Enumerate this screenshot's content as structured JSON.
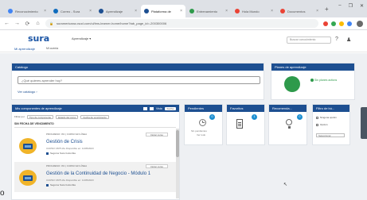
{
  "browser": {
    "tabs": [
      {
        "label": "Reconocimiento",
        "color": "#4285f4",
        "active": false
      },
      {
        "label": "Correo - Sura",
        "color": "#0f6cbd",
        "active": false
      },
      {
        "label": "Aprendizaje",
        "color": "#1d4f91",
        "active": false
      },
      {
        "label": "Plataforma de",
        "color": "#1d4f91",
        "active": true
      },
      {
        "label": "Entrenamiento",
        "color": "#2e9a4b",
        "active": false
      },
      {
        "label": "Hola Mundo",
        "color": "#ea4335",
        "active": false
      },
      {
        "label": "Documentos",
        "color": "#ea4335",
        "active": false
      }
    ],
    "new_tab": "+",
    "window_controls": [
      "–",
      "❐",
      "✕"
    ],
    "url": "suramericana.csod.com/ui/lms-learner-home/home?tab_page_id=-200300006",
    "nav_icons": [
      "←",
      "→",
      "⟳",
      "⌂"
    ]
  },
  "site": {
    "logo": "sura",
    "logo_tagline": "Mi aprendizaje",
    "logo_menu": "Mi cuenta",
    "nav_label": "Aprendizaje ▾",
    "search_placeholder": "Buscar conocimiento",
    "header_icons": [
      "?",
      "♟"
    ]
  },
  "catalog": {
    "title": "Catálogo",
    "input_placeholder": "¿Qué quieres aprender hoy?",
    "link": "Ver catálogo ›"
  },
  "plan": {
    "title": "Planes de aprendizaje",
    "status_text": "Sin planes activos",
    "accent": "#2e9a4b"
  },
  "my_components": {
    "title": "Mis componentes de aprendizaje",
    "view_label": "Vista",
    "sort_label": "Fecha",
    "filters": [
      "Filtrar por",
      "Tipo de componente",
      "Estado del curso",
      "Fecha de vencimiento"
    ],
    "section_label": "SIN FECHA DE VENCIMIENTO",
    "courses": [
      {
        "meta": "PROGRESO: 0%  |  CURSO EN LÍNEA",
        "title": "Gestión de Crisis",
        "sub": "CURSO VIRTUAL Disponible en: 11/05/2023",
        "owner": "Seguros Sura Colombia",
        "action": "Iniciar curso"
      },
      {
        "meta": "PROGRESO: 0%  |  CURSO EN LÍNEA",
        "title": "Gestión de la Continuidad de Negocio - Módulo 1",
        "sub": "CURSO VIRTUAL Disponible en: 11/05/2023",
        "owner": "Seguros Sura Colombia",
        "action": "Iniciar curso"
      }
    ]
  },
  "cards": {
    "pending": {
      "title": "Pendientes",
      "badge": "0",
      "caption": "Sin pendientes",
      "caption2": "Ver todo"
    },
    "favorites": {
      "title": "Favoritos",
      "badge": "1"
    },
    "recommended": {
      "title": "Recomenda...",
      "badge": "0"
    },
    "filter": {
      "title": "Filtro de bú...",
      "check1": "Ninguna opción",
      "check2": "Opción",
      "dropdown": "Seleccionar"
    }
  },
  "colors": {
    "primary": "#1d4f91",
    "badge": "#1d8fd1",
    "course_icon": "#f0b429"
  },
  "stray_glyph": "o"
}
